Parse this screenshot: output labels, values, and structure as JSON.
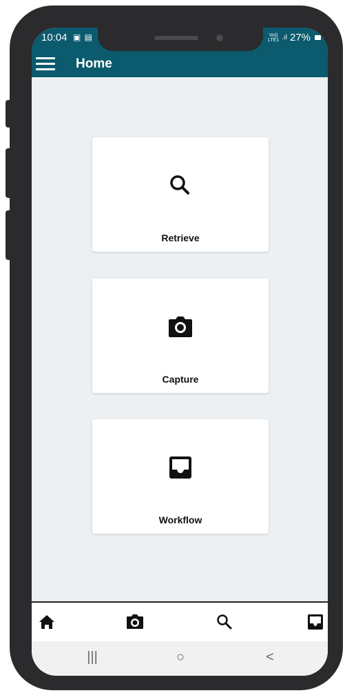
{
  "status_bar": {
    "time": "10:04",
    "left_icons": "▣ ▤",
    "volte_top": "Vo))",
    "volte_bottom": "LTE1",
    "signal": ".ıl",
    "battery_percent": "27%"
  },
  "app_bar": {
    "title": "Home",
    "menu_icon": "hamburger-menu-icon"
  },
  "cards": [
    {
      "label": "Retrieve",
      "icon": "search-icon"
    },
    {
      "label": "Capture",
      "icon": "camera-icon"
    },
    {
      "label": "Workflow",
      "icon": "inbox-icon"
    }
  ],
  "bottom_nav": {
    "items": [
      "home-icon",
      "camera-icon",
      "search-icon",
      "inbox-icon"
    ]
  },
  "system_nav": {
    "recents": "|||",
    "home": "○",
    "back": "<"
  },
  "colors": {
    "app_bar": "#0b5a6e",
    "background": "#ecf0f3",
    "card": "#ffffff",
    "icon": "#111111"
  }
}
